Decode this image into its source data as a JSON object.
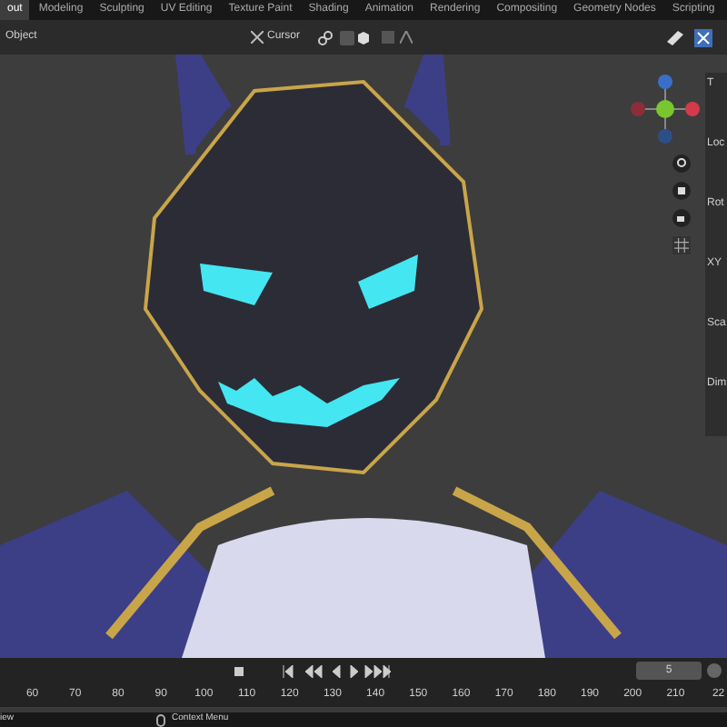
{
  "workspace_tabs": [
    {
      "label": "out",
      "selected": true
    },
    {
      "label": "Modeling",
      "selected": false
    },
    {
      "label": "Sculpting",
      "selected": false
    },
    {
      "label": "UV Editing",
      "selected": false
    },
    {
      "label": "Texture Paint",
      "selected": false
    },
    {
      "label": "Shading",
      "selected": false
    },
    {
      "label": "Animation",
      "selected": false
    },
    {
      "label": "Rendering",
      "selected": false
    },
    {
      "label": "Compositing",
      "selected": false
    },
    {
      "label": "Geometry Nodes",
      "selected": false
    },
    {
      "label": "Scripting",
      "selected": false
    }
  ],
  "viewport_header": {
    "mode": "Object",
    "pivot": "Cursor"
  },
  "sidebar": {
    "sections": [
      "T",
      "Loc",
      "Rot",
      "XY",
      "Sca",
      "Dim"
    ]
  },
  "timeline": {
    "current_frame": "5",
    "ruler": [
      "60",
      "70",
      "80",
      "90",
      "100",
      "110",
      "120",
      "130",
      "140",
      "150",
      "160",
      "170",
      "180",
      "190",
      "200",
      "210",
      "22"
    ]
  },
  "status_bar": {
    "left": "iew",
    "hint": "Context Menu"
  }
}
